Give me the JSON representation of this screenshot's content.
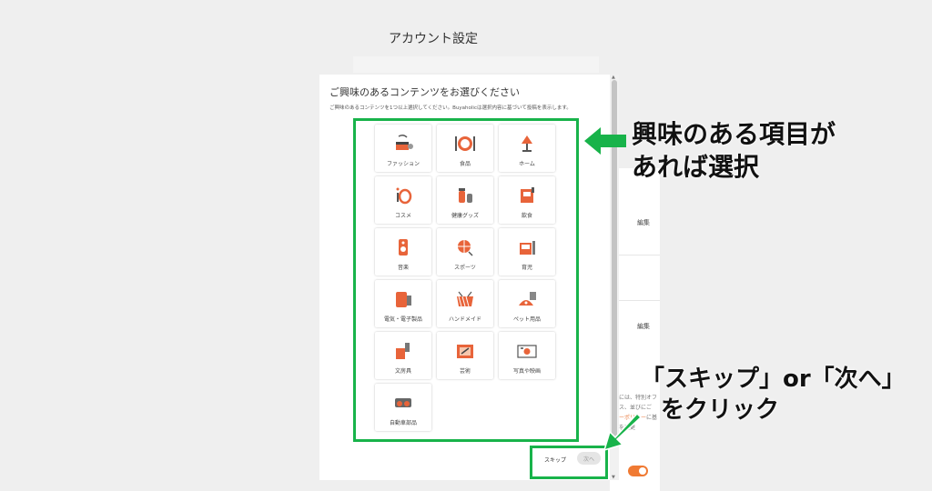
{
  "background": {
    "page_title": "アカウント設定",
    "edit_label": "編集",
    "text_line1": "には、特別オフ",
    "text_line2": "ス、並びにご",
    "link_text": "ーポリシー",
    "text_line3": "に基",
    "text_line4": "を変更"
  },
  "modal": {
    "title": "ご興味のあるコンテンツをお選びください",
    "description": "ご興味のあるコンテンツを1つ以上選択してください。Buyaholicは選択内容に基づいて投稿を表示します。",
    "categories": [
      {
        "label": "ファッション",
        "icon": "fashion-icon"
      },
      {
        "label": "食品",
        "icon": "food-icon"
      },
      {
        "label": "ホーム",
        "icon": "home-lamp-icon"
      },
      {
        "label": "コスメ",
        "icon": "cosmetics-icon"
      },
      {
        "label": "健康グッズ",
        "icon": "health-goods-icon"
      },
      {
        "label": "飲食",
        "icon": "drink-food-icon"
      },
      {
        "label": "音楽",
        "icon": "music-speaker-icon"
      },
      {
        "label": "スポーツ",
        "icon": "sports-ball-icon"
      },
      {
        "label": "育児",
        "icon": "childcare-icon"
      },
      {
        "label": "電気・電子製品",
        "icon": "electronics-icon"
      },
      {
        "label": "ハンドメイド",
        "icon": "handmade-icon"
      },
      {
        "label": "ペット用品",
        "icon": "pet-supplies-icon"
      },
      {
        "label": "文房具",
        "icon": "stationery-icon"
      },
      {
        "label": "芸術",
        "icon": "art-icon"
      },
      {
        "label": "写真や映画",
        "icon": "photo-film-icon"
      },
      {
        "label": "自動車部品",
        "icon": "car-parts-icon"
      }
    ],
    "skip_label": "スキップ",
    "next_label": "次へ"
  },
  "annotations": {
    "interest_line1": "興味のある項目が",
    "interest_line2": "あれば選択",
    "click_line1": "「スキップ」or「次へ」",
    "click_line2": "をクリック"
  },
  "colors": {
    "accent_orange": "#f07a33",
    "highlight_green": "#18b34a"
  }
}
